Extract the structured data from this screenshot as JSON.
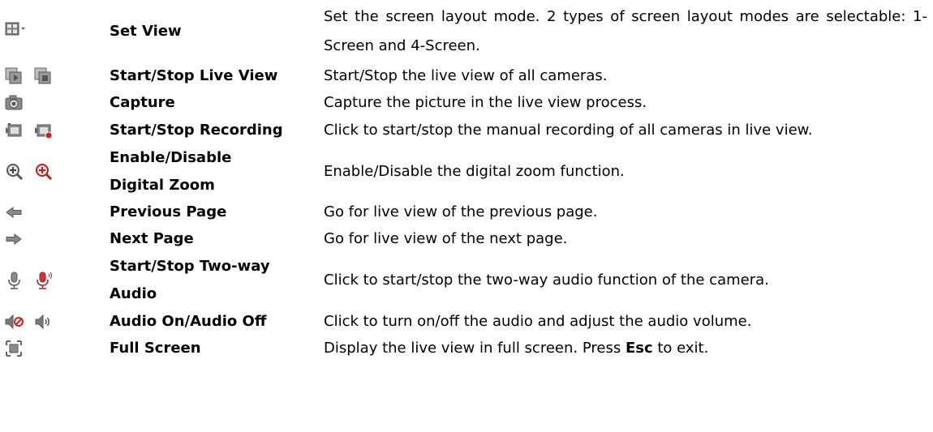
{
  "rows": [
    {
      "name": "Set View",
      "desc": "Set the screen layout mode. 2 types of screen layout modes are selectable: 1-Screen and 4-Screen.",
      "icons": [
        "layout-grid-dropdown-icon"
      ]
    },
    {
      "name": "Start/Stop Live View",
      "desc": "Start/Stop the live view of all cameras.",
      "icons": [
        "start-live-view-icon",
        "stop-live-view-icon"
      ]
    },
    {
      "name": "Capture",
      "desc": "Capture the picture in the live view process.",
      "icons": [
        "camera-capture-icon"
      ]
    },
    {
      "name": "Start/Stop Recording",
      "desc": "Click to start/stop the manual recording of all cameras in live view.",
      "icons": [
        "start-recording-icon",
        "stop-recording-icon"
      ]
    },
    {
      "name": "Enable/Disable Digital Zoom",
      "desc": "Enable/Disable the digital zoom function.",
      "icons": [
        "zoom-in-icon",
        "zoom-in-active-icon"
      ]
    },
    {
      "name": "Previous Page",
      "desc": "Go for live view of the previous page.",
      "icons": [
        "arrow-left-icon"
      ]
    },
    {
      "name": "Next Page",
      "desc": "Go for live view of the next page.",
      "icons": [
        "arrow-right-icon"
      ]
    },
    {
      "name": "Start/Stop Two-way Audio",
      "desc": "Click to start/stop the two-way audio function of the camera.",
      "icons": [
        "microphone-icon",
        "microphone-active-icon"
      ]
    },
    {
      "name": "Audio On/Audio Off",
      "desc": "Click to turn on/off the audio and adjust the audio volume.",
      "icons": [
        "speaker-muted-icon",
        "speaker-on-icon"
      ]
    },
    {
      "name": "Full Screen",
      "desc_before": "Display the live view in full screen. Press ",
      "desc_key": "Esc",
      "desc_after": " to exit.",
      "icons": [
        "full-screen-icon"
      ]
    }
  ],
  "colors": {
    "icon_gray": "#8a8a8a",
    "icon_dark": "#5a5a5a",
    "accent_red": "#cc2222",
    "accent_green": "#3a9a3a"
  }
}
